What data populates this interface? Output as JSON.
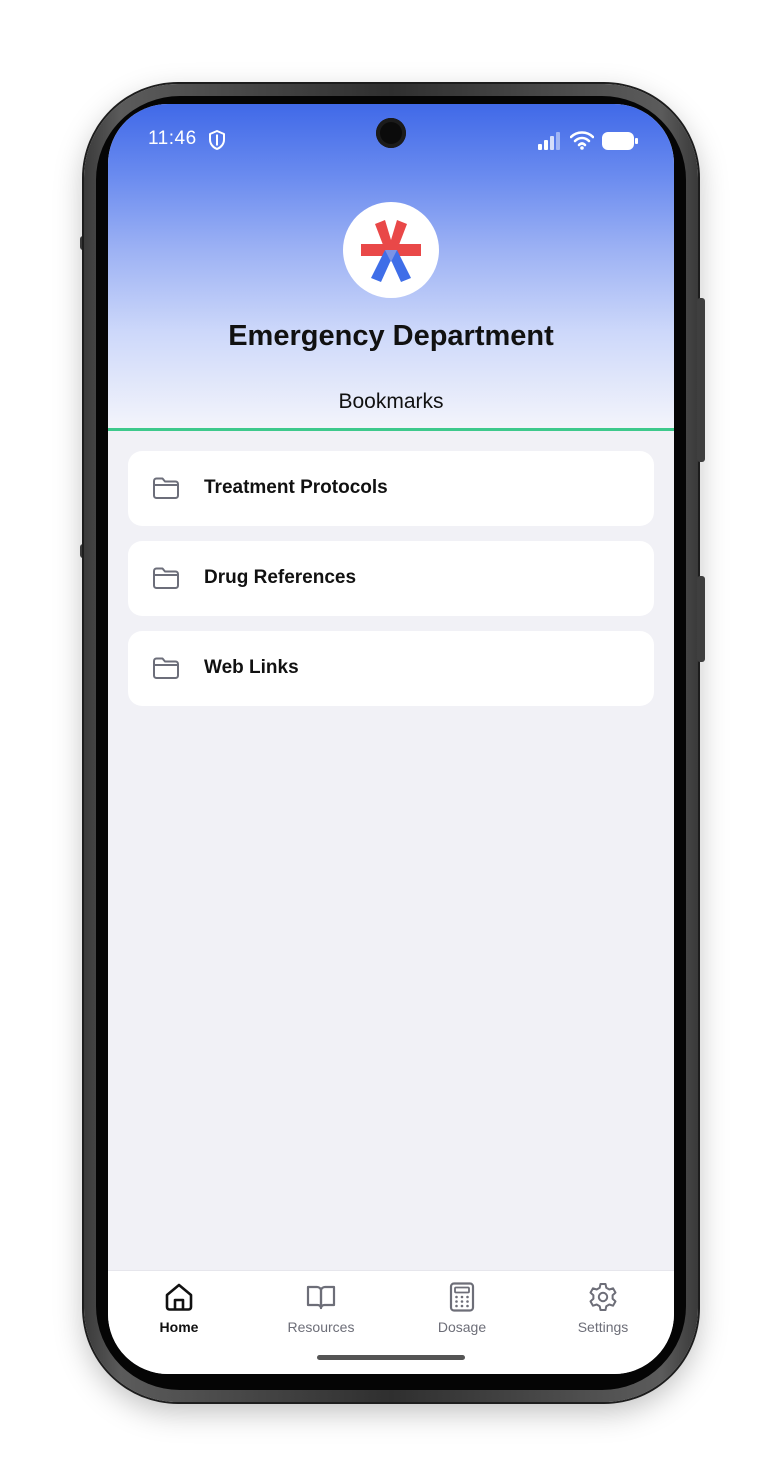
{
  "status_bar": {
    "time": "11:46"
  },
  "header": {
    "title": "Emergency Department",
    "tab_label": "Bookmarks"
  },
  "bookmarks": [
    {
      "label": "Treatment Protocols",
      "icon": "folder-icon"
    },
    {
      "label": "Drug References",
      "icon": "folder-icon"
    },
    {
      "label": "Web Links",
      "icon": "folder-icon"
    }
  ],
  "bottom_nav": {
    "items": [
      {
        "label": "Home",
        "icon": "home-icon",
        "active": true
      },
      {
        "label": "Resources",
        "icon": "book-icon",
        "active": false
      },
      {
        "label": "Dosage",
        "icon": "calculator-icon",
        "active": false
      },
      {
        "label": "Settings",
        "icon": "gear-icon",
        "active": false
      }
    ]
  },
  "colors": {
    "header_top": "#4069e8",
    "tab_indicator": "#3ec98c",
    "logo_red": "#e94848",
    "logo_blue": "#3f6ee8",
    "background": "#f1f1f6"
  }
}
